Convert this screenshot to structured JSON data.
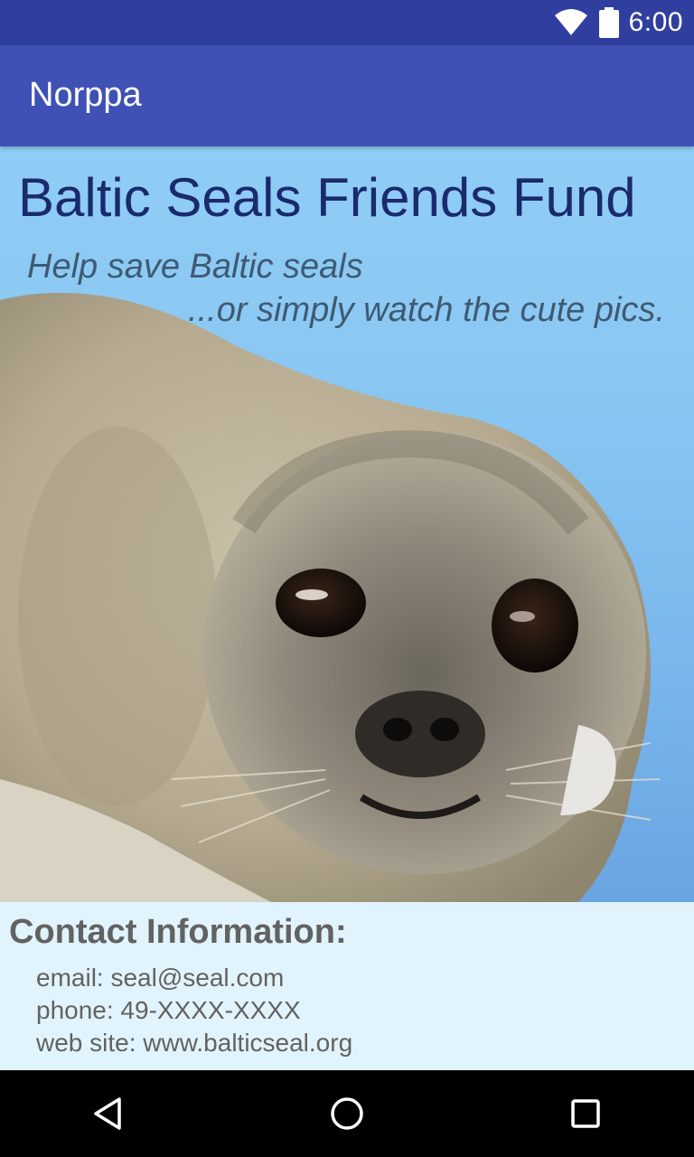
{
  "status_bar": {
    "time": "6:00",
    "icons": [
      "wifi-icon",
      "battery-icon"
    ]
  },
  "app_bar": {
    "title": "Norppa"
  },
  "hero": {
    "title": "Baltic Seals Friends Fund",
    "subtitle_line1": "Help save Baltic seals",
    "subtitle_line2": "...or simply watch the cute pics."
  },
  "contact": {
    "heading": "Contact Information:",
    "email": "email: seal@seal.com",
    "phone": "phone: 49-XXXX-XXXX",
    "website": "web site: www.balticseal.org"
  },
  "nav_bar": {
    "icons": [
      "back-icon",
      "home-icon",
      "recents-icon"
    ]
  },
  "colors": {
    "status_bar": "#303f9f",
    "app_bar": "#3f51b5",
    "hero_title": "#1a2a6c",
    "contact_bg": "#e1f4fd"
  }
}
